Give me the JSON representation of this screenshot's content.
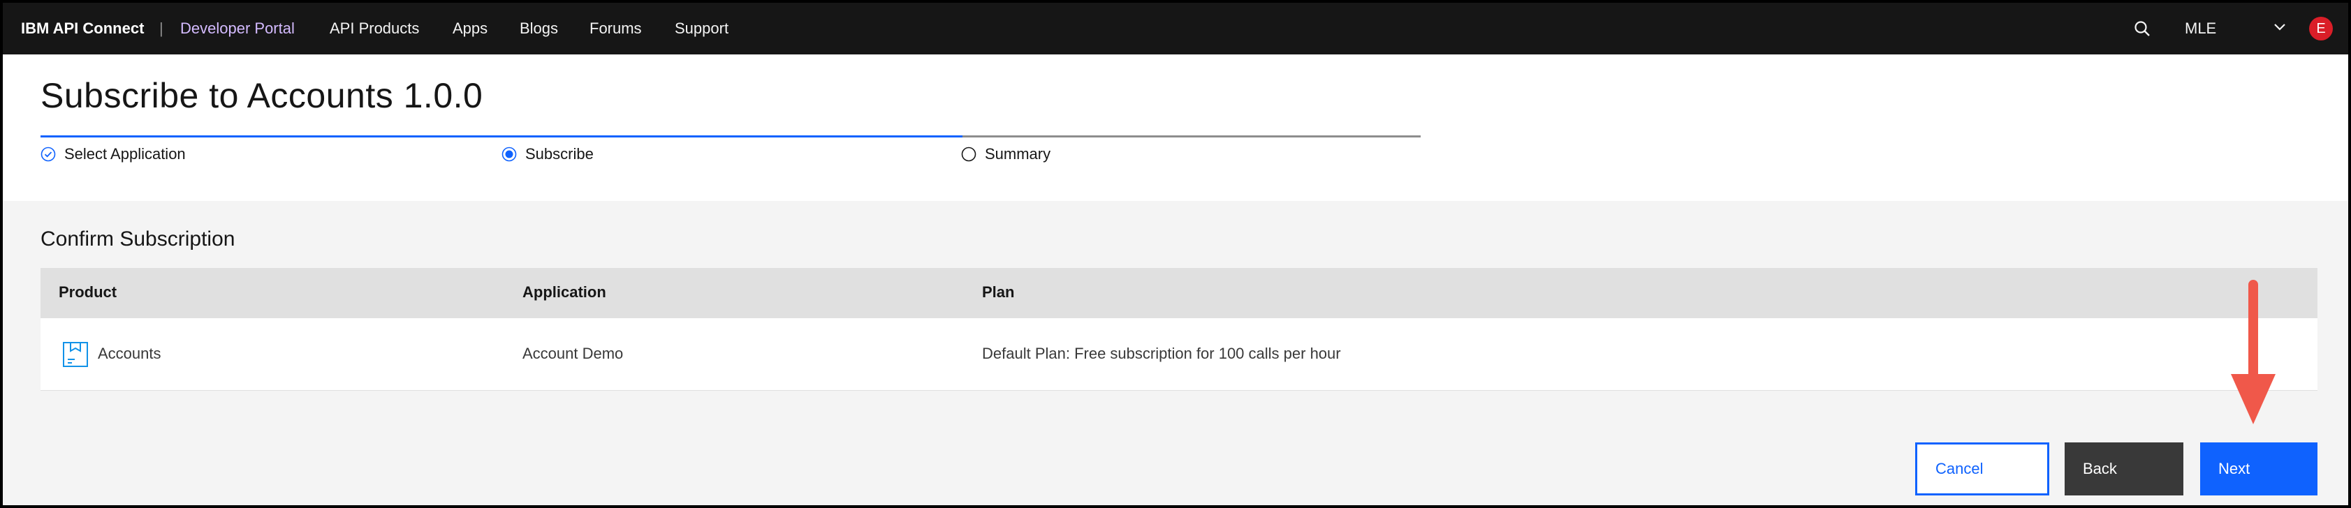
{
  "nav": {
    "brand": "IBM API Connect",
    "separator": "|",
    "portal": "Developer Portal",
    "links": [
      "API Products",
      "Apps",
      "Blogs",
      "Forums",
      "Support"
    ],
    "search_icon": "search-icon",
    "user": "MLE",
    "avatar_initial": "E",
    "avatar_color": "#da1e28"
  },
  "page": {
    "title": "Subscribe to Accounts 1.0.0"
  },
  "steps": [
    {
      "label": "Select Application",
      "state": "complete",
      "icon": "checkmark-outline-icon"
    },
    {
      "label": "Subscribe",
      "state": "current",
      "icon": "radio-selected-icon"
    },
    {
      "label": "Summary",
      "state": "incomplete",
      "icon": "radio-empty-icon"
    }
  ],
  "confirm": {
    "title": "Confirm Subscription",
    "columns": [
      "Product",
      "Application",
      "Plan"
    ],
    "rows": [
      {
        "product": "Accounts",
        "product_icon": "product-box-icon",
        "application": "Account Demo",
        "plan": "Default Plan: Free subscription for 100 calls per hour"
      }
    ]
  },
  "buttons": {
    "cancel": "Cancel",
    "back": "Back",
    "next": "Next"
  },
  "colors": {
    "accent": "#0f62fe",
    "portal_link": "#d4bbff",
    "annotation_arrow": "#f0584a"
  }
}
